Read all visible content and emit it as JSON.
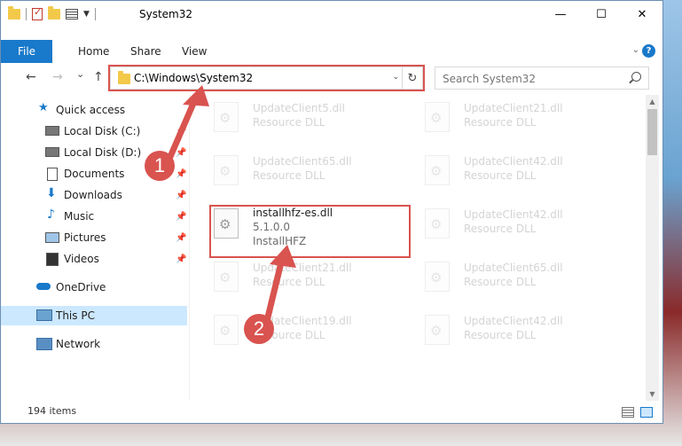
{
  "window": {
    "title": "System32",
    "minimize": "—",
    "maximize": "☐",
    "close": "✕"
  },
  "ribbon": {
    "tabs": [
      "File",
      "Home",
      "Share",
      "View"
    ],
    "help": "?"
  },
  "nav": {
    "back": "←",
    "forward": "→",
    "recent": "⌄",
    "up": "↑"
  },
  "address": {
    "path": "C:\\Windows\\System32",
    "dropdown": "⌄",
    "refresh": "↻"
  },
  "search": {
    "placeholder": "Search System32"
  },
  "sidebar": {
    "items": [
      {
        "label": "Quick access",
        "icon": "star-icon"
      },
      {
        "label": "Local Disk (C:)",
        "icon": "drive-icon"
      },
      {
        "label": "Local Disk (D:)",
        "icon": "drive-icon"
      },
      {
        "label": "Documents",
        "icon": "documents-icon"
      },
      {
        "label": "Downloads",
        "icon": "downloads-icon"
      },
      {
        "label": "Music",
        "icon": "music-icon"
      },
      {
        "label": "Pictures",
        "icon": "pictures-icon"
      },
      {
        "label": "Videos",
        "icon": "videos-icon"
      },
      {
        "label": "OneDrive",
        "icon": "cloud-icon"
      },
      {
        "label": "This PC",
        "icon": "pc-icon"
      },
      {
        "label": "Network",
        "icon": "network-icon"
      }
    ],
    "pin": "📌"
  },
  "files": [
    {
      "name": "UpdateClient5.dll",
      "desc": "Resource DLL"
    },
    {
      "name": "UpdateClient21.dll",
      "desc": "Resource DLL"
    },
    {
      "name": "UpdateClient65.dll",
      "desc": "Resource DLL"
    },
    {
      "name": "UpdateClient42.dll",
      "desc": "Resource DLL"
    },
    {
      "name": "installhfz-es.dll",
      "version": "5.1.0.0",
      "desc": "InstallHFZ"
    },
    {
      "name": "UpdateClient42.dll",
      "desc": "Resource DLL"
    },
    {
      "name": "UpdateClient21.dll",
      "desc": "Resource DLL"
    },
    {
      "name": "UpdateClient65.dll",
      "desc": "Resource DLL"
    },
    {
      "name": "UpdateClient19.dll",
      "desc": "Resource DLL"
    },
    {
      "name": "UpdateClient42.dll",
      "desc": "Resource DLL"
    }
  ],
  "status": {
    "count": "194 items"
  },
  "annotations": {
    "step1": "1",
    "step2": "2",
    "color": "#d9534f"
  }
}
